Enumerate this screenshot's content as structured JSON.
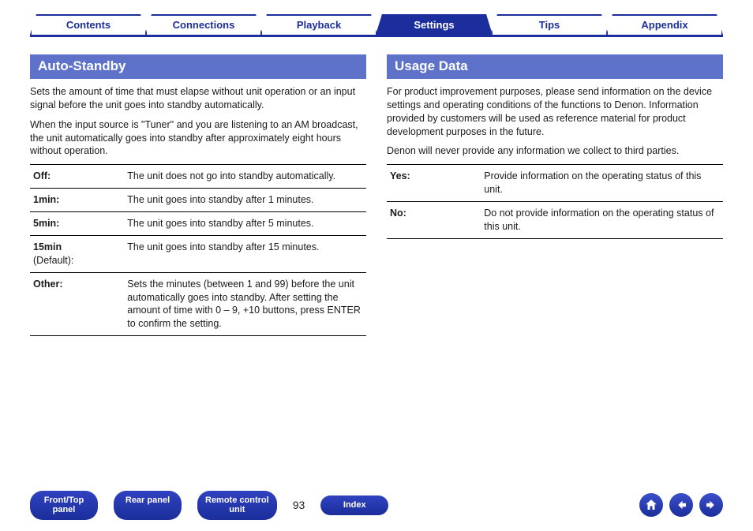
{
  "tabs": [
    {
      "id": "contents",
      "label": "Contents",
      "active": false
    },
    {
      "id": "connections",
      "label": "Connections",
      "active": false
    },
    {
      "id": "playback",
      "label": "Playback",
      "active": false
    },
    {
      "id": "settings",
      "label": "Settings",
      "active": true
    },
    {
      "id": "tips",
      "label": "Tips",
      "active": false
    },
    {
      "id": "appendix",
      "label": "Appendix",
      "active": false
    }
  ],
  "left": {
    "title": "Auto-Standby",
    "para1": "Sets the amount of time that must elapse without unit operation or an input signal before the unit goes into standby automatically.",
    "para2": "When the input source is \"Tuner\" and you are listening to an AM broadcast, the unit automatically goes into standby after approximately eight hours without operation.",
    "rows": [
      {
        "key": "Off:",
        "desc": "The unit does not go into standby automatically."
      },
      {
        "key": "1min:",
        "desc": "The unit goes into standby after 1 minutes."
      },
      {
        "key": "5min:",
        "desc": "The unit goes into standby after 5 minutes."
      },
      {
        "key": "15min",
        "sub": "(Default):",
        "desc": "The unit goes into standby after 15 minutes."
      },
      {
        "key": "Other:",
        "desc": "Sets the minutes (between 1 and 99) before the unit automatically goes into standby. After setting the amount of time with 0 – 9, +10 buttons, press ENTER to confirm the setting."
      }
    ]
  },
  "right": {
    "title": "Usage Data",
    "para1": "For product improvement purposes, please send information on the device settings and operating conditions of the functions to Denon. Information provided by customers will be used as reference material for product development purposes in the future.",
    "para2": "Denon will never provide any information we collect to third parties.",
    "rows": [
      {
        "key": "Yes:",
        "desc": "Provide information on the operating status of this unit."
      },
      {
        "key": "No:",
        "desc": "Do not provide information on the operating status of this unit."
      }
    ]
  },
  "footer": {
    "links": [
      {
        "id": "front-top-panel",
        "label": "Front/Top\npanel"
      },
      {
        "id": "rear-panel",
        "label": "Rear panel"
      },
      {
        "id": "remote-control-unit",
        "label": "Remote control\nunit"
      }
    ],
    "page": "93",
    "index_label": "Index"
  }
}
